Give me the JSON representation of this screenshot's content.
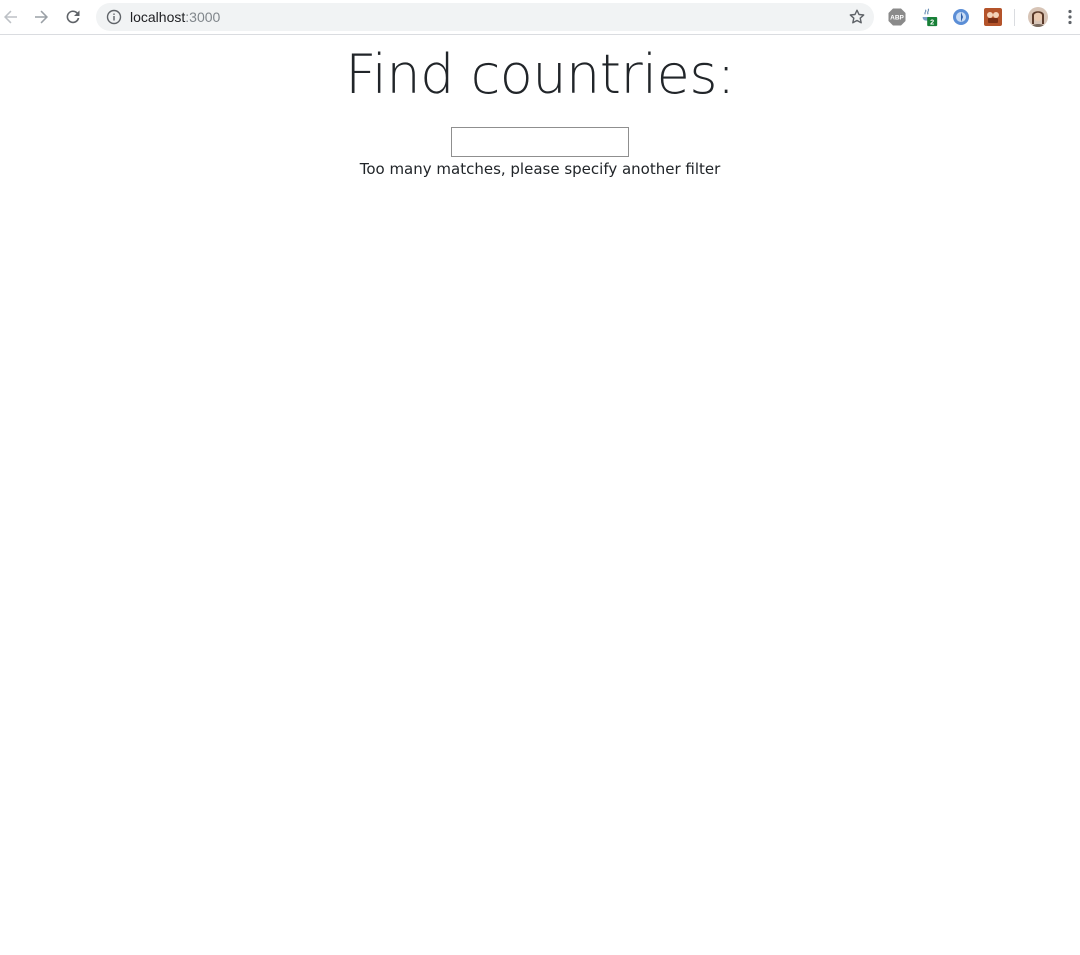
{
  "browser": {
    "url_host": "localhost",
    "url_port": ":3000",
    "extensions": {
      "java_badge": "2"
    },
    "colors": {
      "toolbar_icon": "#5f6368",
      "disabled_icon": "#9aa0a6",
      "badge_green": "#188038"
    }
  },
  "page": {
    "title": "Find countries:",
    "search": {
      "value": "",
      "placeholder": ""
    },
    "message": "Too many matches, please specify another filter"
  }
}
